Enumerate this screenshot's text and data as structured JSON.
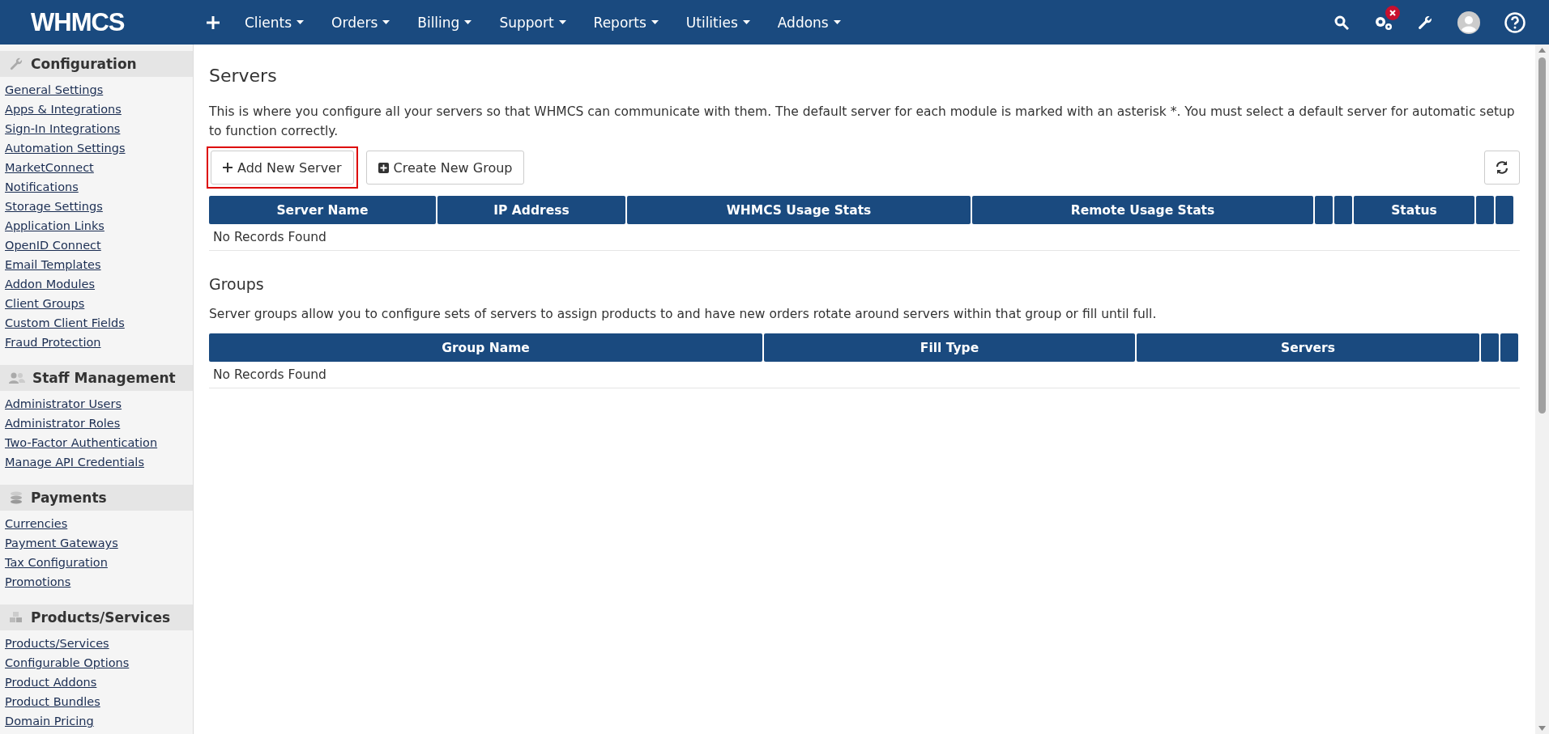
{
  "topbar": {
    "logo": "WHMCS",
    "menu": [
      {
        "label": "Clients"
      },
      {
        "label": "Orders"
      },
      {
        "label": "Billing"
      },
      {
        "label": "Support"
      },
      {
        "label": "Reports"
      },
      {
        "label": "Utilities"
      },
      {
        "label": "Addons"
      }
    ]
  },
  "sidebar": {
    "sections": [
      {
        "title": "Configuration",
        "items": [
          "General Settings",
          "Apps & Integrations",
          "Sign-In Integrations",
          "Automation Settings",
          "MarketConnect",
          "Notifications",
          "Storage Settings",
          "Application Links",
          "OpenID Connect",
          "Email Templates",
          "Addon Modules",
          "Client Groups",
          "Custom Client Fields",
          "Fraud Protection"
        ]
      },
      {
        "title": "Staff Management",
        "items": [
          "Administrator Users",
          "Administrator Roles",
          "Two-Factor Authentication",
          "Manage API Credentials"
        ]
      },
      {
        "title": "Payments",
        "items": [
          "Currencies",
          "Payment Gateways",
          "Tax Configuration",
          "Promotions"
        ]
      },
      {
        "title": "Products/Services",
        "items": [
          "Products/Services",
          "Configurable Options",
          "Product Addons",
          "Product Bundles",
          "Domain Pricing"
        ]
      }
    ]
  },
  "page": {
    "title": "Servers",
    "description": "This is where you configure all your servers so that WHMCS can communicate with them. The default server for each module is marked with an asterisk *. You must select a default server for automatic setup to function correctly.",
    "buttons": [
      {
        "label": "Add New Server",
        "highlighted": true
      },
      {
        "label": "Create New Group",
        "highlighted": false
      }
    ],
    "servers_table": {
      "columns": [
        {
          "kind": "text",
          "label": "Server Name"
        },
        {
          "kind": "text",
          "label": "IP Address"
        },
        {
          "kind": "text",
          "label": "WHMCS Usage Stats"
        },
        {
          "kind": "text",
          "label": "Remote Usage Stats"
        },
        {
          "kind": "blank"
        },
        {
          "kind": "blank"
        },
        {
          "kind": "text",
          "label": "Status"
        },
        {
          "kind": "blank"
        },
        {
          "kind": "blank"
        }
      ],
      "empty_message": "No Records Found"
    },
    "groups_title": "Groups",
    "groups_description": "Server groups allow you to configure sets of servers to assign products to and have new orders rotate around servers within that group or fill until full.",
    "groups_table": {
      "columns": [
        {
          "kind": "text",
          "label": "Group Name"
        },
        {
          "kind": "text",
          "label": "Fill Type"
        },
        {
          "kind": "text",
          "label": "Servers"
        },
        {
          "kind": "blank"
        },
        {
          "kind": "blank"
        }
      ],
      "empty_message": "No Records Found"
    }
  }
}
